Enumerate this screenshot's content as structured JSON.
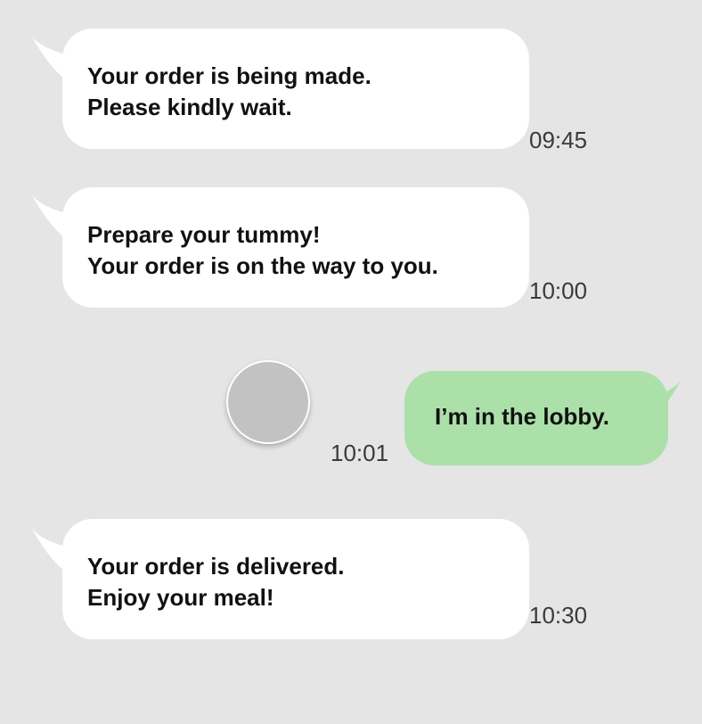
{
  "colors": {
    "background": "#e5e5e5",
    "incoming_bubble": "#ffffff",
    "outgoing_bubble": "#abe1a9",
    "avatar": "#c2c2c2",
    "timestamp": "#3a3a3a"
  },
  "messages": [
    {
      "direction": "incoming",
      "lines": [
        "Your order is being made.",
        "Please kindly wait."
      ],
      "time": "09:45"
    },
    {
      "direction": "incoming",
      "lines": [
        "Prepare your tummy!",
        "Your order is on the way to you."
      ],
      "time": "10:00"
    },
    {
      "direction": "outgoing",
      "lines": [
        "I’m in the lobby."
      ],
      "time": "10:01"
    },
    {
      "direction": "incoming",
      "lines": [
        "Your order is delivered.",
        "Enjoy your meal!"
      ],
      "time": "10:30"
    }
  ]
}
